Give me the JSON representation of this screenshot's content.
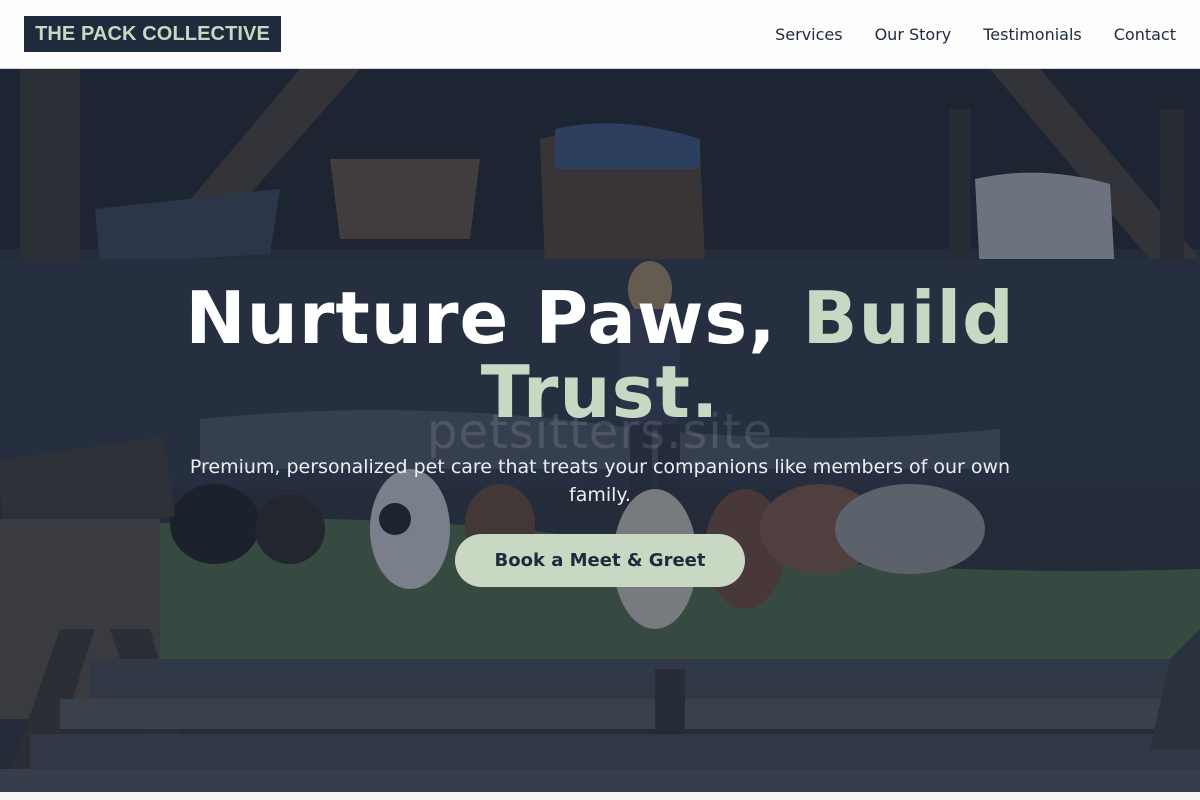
{
  "brand": {
    "logo_text": "THE PACK COLLECTIVE"
  },
  "nav": {
    "items": [
      {
        "label": "Services"
      },
      {
        "label": "Our Story"
      },
      {
        "label": "Testimonials"
      },
      {
        "label": "Contact"
      }
    ]
  },
  "hero": {
    "title_main": "Nurture Paws, ",
    "title_accent": "Build Trust.",
    "watermark": "petsitters.site",
    "subtitle": "Premium, personalized pet care that treats your companions like members of our own family.",
    "cta_label": "Book a Meet & Greet",
    "background_image": "dog-walker-with-pack-of-dogs-at-dock-photo"
  },
  "colors": {
    "navy": "#1f2a3c",
    "sage": "#c8d8c3",
    "white": "#ffffff"
  }
}
